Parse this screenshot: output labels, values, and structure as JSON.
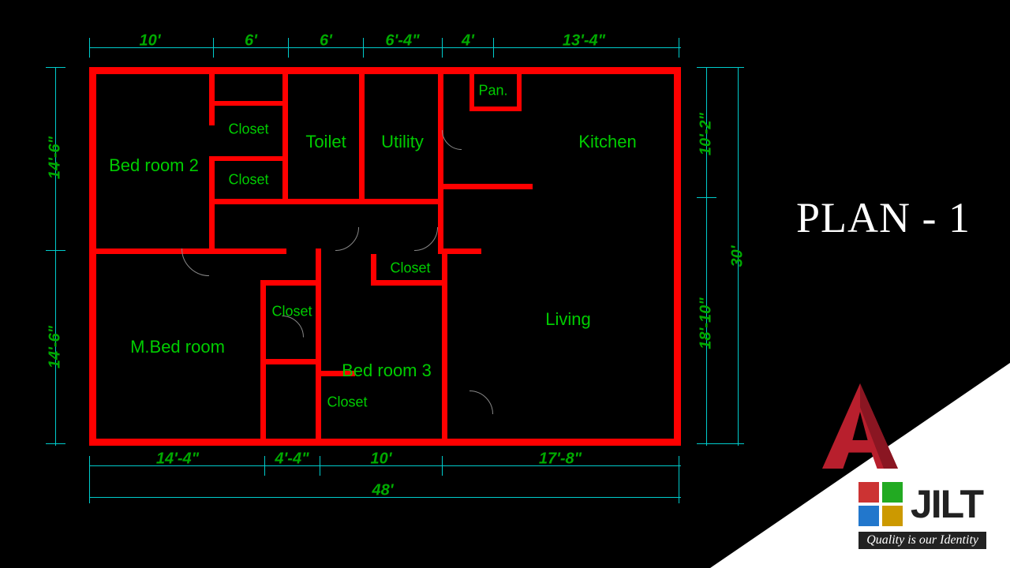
{
  "plan_title": "PLAN - 1",
  "dimensions": {
    "top": {
      "d1": "10'",
      "d2": "6'",
      "d3": "6'",
      "d4": "6'-4\"",
      "d5": "4'",
      "d6": "13'-4\""
    },
    "bottom": {
      "d1": "14'-4\"",
      "d2": "4'-4\"",
      "d3": "10'",
      "d4": "17'-8\"",
      "total": "48'"
    },
    "left": {
      "d1": "14'-6\"",
      "d2": "14'-6\""
    },
    "right": {
      "d1": "10'-2\"",
      "d2": "18'-10\"",
      "total": "30'"
    }
  },
  "rooms": {
    "bedroom2": "Bed room 2",
    "closet": "Closet",
    "toilet": "Toilet",
    "utility": "Utility",
    "pan": "Pan.",
    "kitchen": "Kitchen",
    "living": "Living",
    "mbed": "M.Bed room",
    "bedroom3": "Bed room 3"
  },
  "brand": {
    "name": "JILT",
    "tagline": "Quality is our Identity"
  },
  "colors": {
    "wall": "#ff0000",
    "dimension_line": "#00cccc",
    "dimension_text": "#00aa00",
    "room_text": "#00cc00",
    "background": "#000000"
  }
}
